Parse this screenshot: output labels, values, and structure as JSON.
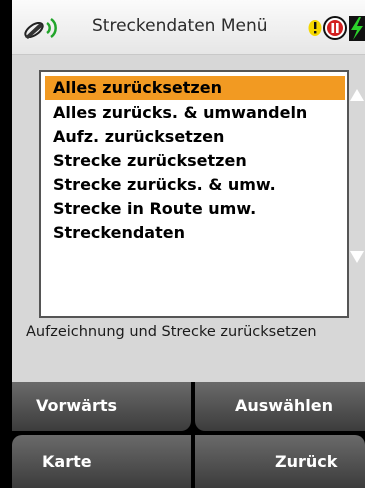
{
  "header": {
    "title": "Streckendaten Menü",
    "icons": [
      "satellite-signal-icon",
      "alert-icon",
      "pause-icon",
      "battery-charging-icon"
    ],
    "colors": {
      "alert": "#f5d800",
      "pause": "#d21f1f",
      "battery": "#2bd12b"
    }
  },
  "menu": {
    "items": [
      {
        "label": "Alles zurücksetzen",
        "selected": true
      },
      {
        "label": "Alles zurücks. & umwandeln",
        "selected": false
      },
      {
        "label": "Aufz. zurücksetzen",
        "selected": false
      },
      {
        "label": "Strecke zurücksetzen",
        "selected": false
      },
      {
        "label": "Strecke zurücks. & umw.",
        "selected": false
      },
      {
        "label": "Strecke in Route umw.",
        "selected": false
      },
      {
        "label": "Streckendaten",
        "selected": false
      }
    ],
    "selection_color": "#f29a22"
  },
  "description": "Aufzeichnung und Strecke zurücksetzen",
  "softkeys": {
    "top_left": "Vorwärts",
    "top_right": "Auswählen",
    "bottom_left": "Karte",
    "bottom_right": "Zurück"
  }
}
